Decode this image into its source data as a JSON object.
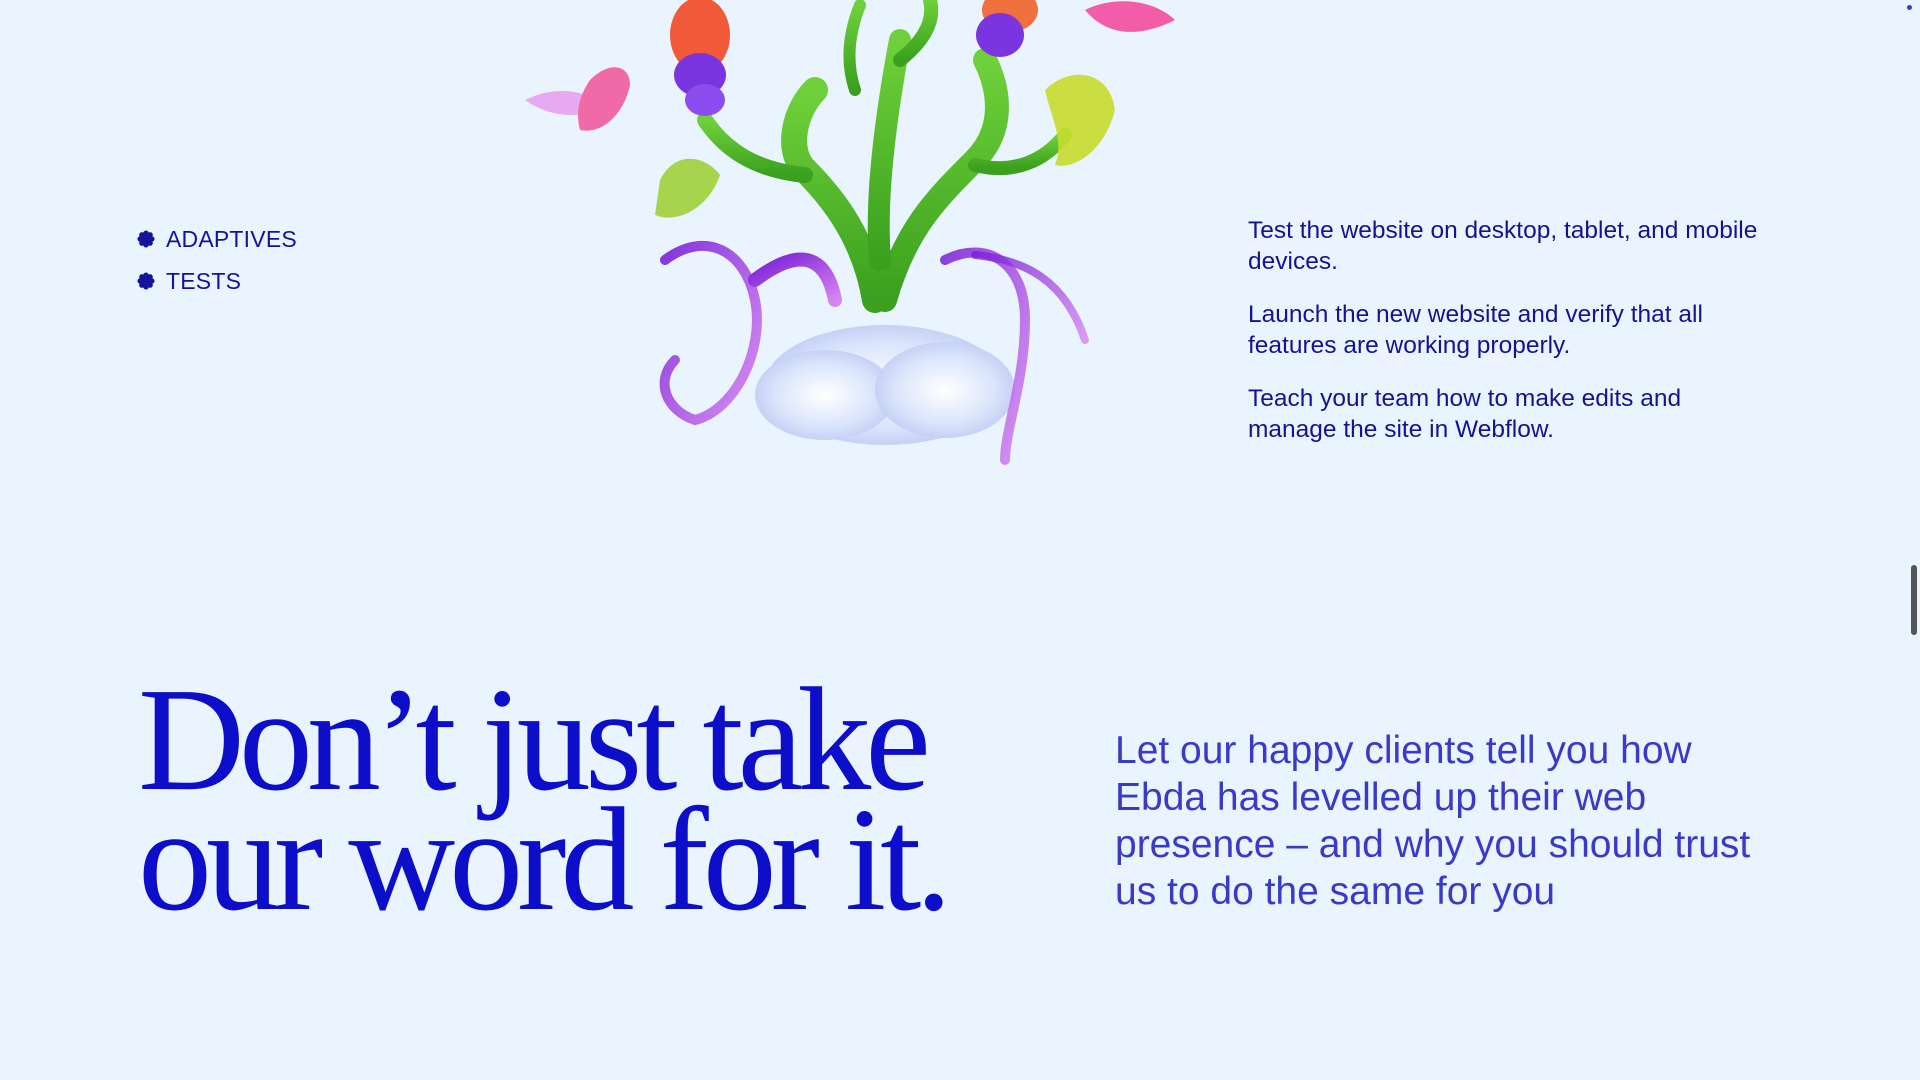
{
  "tags": [
    {
      "label": "ADAPTIVES",
      "icon": "flower-bullet-icon"
    },
    {
      "label": "TESTS",
      "icon": "flower-bullet-icon"
    }
  ],
  "illustration": {
    "icon": "glass-plant-illustration"
  },
  "steps": [
    "Test the website on desktop, tablet, and mobile devices.",
    "Launch the new website and verify that all features are working properly.",
    "Teach your team how to make edits and manage the site in Webflow."
  ],
  "testimonials": {
    "headline_line1": "Don’t just take",
    "headline_line2": "our word for it.",
    "subcopy": "Let our happy clients tell you how Ebda has levelled up their web presence – and why you should trust us to do the same for you"
  },
  "colors": {
    "background": "#e9f4fe",
    "accent": "#0d0ec9",
    "text": "#16138f"
  }
}
